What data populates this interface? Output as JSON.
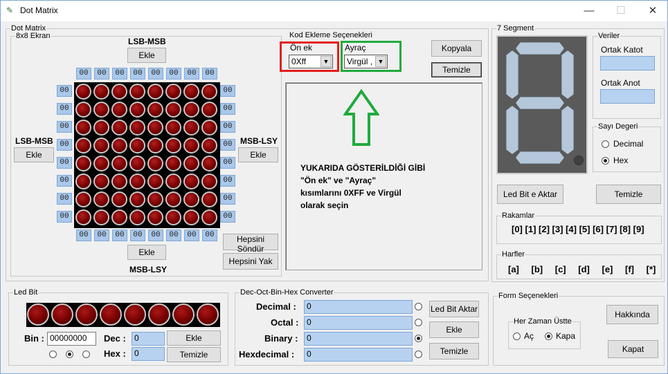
{
  "window": {
    "title": "Dot Matrix",
    "controls": [
      "—",
      "☐",
      "✕"
    ]
  },
  "dot_matrix": {
    "group_label": "Dot Matrix",
    "subgroup_label": "8x8 Ekran",
    "top_label": "LSB-MSB",
    "top_button": "Ekle",
    "left_label": "LSB-MSB",
    "left_button": "Ekle",
    "right_label": "MSB-LSY",
    "right_button": "Ekle",
    "bottom_button": "Ekle",
    "bottom_label": "MSB-LSY",
    "cell_value": "00",
    "all_off_button": "Hepsini Söndür",
    "all_on_button": "Hepsini Yak"
  },
  "code_options": {
    "group_label": "Kod Ekleme Seçenekleri",
    "prefix_label": "Ön ek",
    "prefix_value": "0Xff",
    "separator_label": "Ayraç",
    "separator_value": "Virgül ,",
    "copy_button": "Kopyala",
    "clear_button": "Temizle",
    "instruction_lines": [
      "YUKARIDA GÖSTERİLDİĞİ GİBİ",
      "\"Ön ek\" ve \"Ayraç\"",
      "kısımlarını 0XFF ve Virgül",
      "olarak seçin"
    ]
  },
  "seven_segment": {
    "group_label": "7 Segment",
    "data_label": "Veriler",
    "common_cathode_label": "Ortak Katot",
    "common_anode_label": "Ortak Anot",
    "number_value_label": "Sayı Degeri",
    "decimal_label": "Decimal",
    "hex_label": "Hex",
    "transfer_button": "Led Bit e Aktar",
    "clear_button": "Temizle",
    "digits_label": "Rakamlar",
    "digits": [
      "[0]",
      "[1]",
      "[2]",
      "[3]",
      "[4]",
      "[5]",
      "[6]",
      "[7]",
      "[8]",
      "[9]"
    ],
    "letters_label": "Harfler",
    "letters": [
      "[a]",
      "[b]",
      "[c]",
      "[d]",
      "[e]",
      "[f]",
      "[*]"
    ]
  },
  "led_bit": {
    "group_label": "Led Bit",
    "bin_label": "Bin :",
    "bin_value": "00000000",
    "dec_label": "Dec :",
    "dec_value": "0",
    "hex_label": "Hex :",
    "hex_value": "0",
    "add_button": "Ekle",
    "clear_button": "Temizle"
  },
  "converter": {
    "group_label": "Dec-Oct-Bin-Hex Converter",
    "rows": [
      {
        "label": "Decimal :",
        "value": "0"
      },
      {
        "label": "Octal :",
        "value": "0"
      },
      {
        "label": "Binary :",
        "value": "0"
      },
      {
        "label": "Hexdecimal :",
        "value": "0"
      }
    ],
    "transfer_button": "Led Bit Aktar",
    "add_button": "Ekle",
    "clear_button": "Temizle"
  },
  "form_options": {
    "group_label": "Form Seçenekleri",
    "always_on_top_label": "Her Zaman Üstte",
    "open_label": "Aç",
    "close_label": "Kapa",
    "about_button": "Hakkında",
    "exit_button": "Kapat"
  }
}
